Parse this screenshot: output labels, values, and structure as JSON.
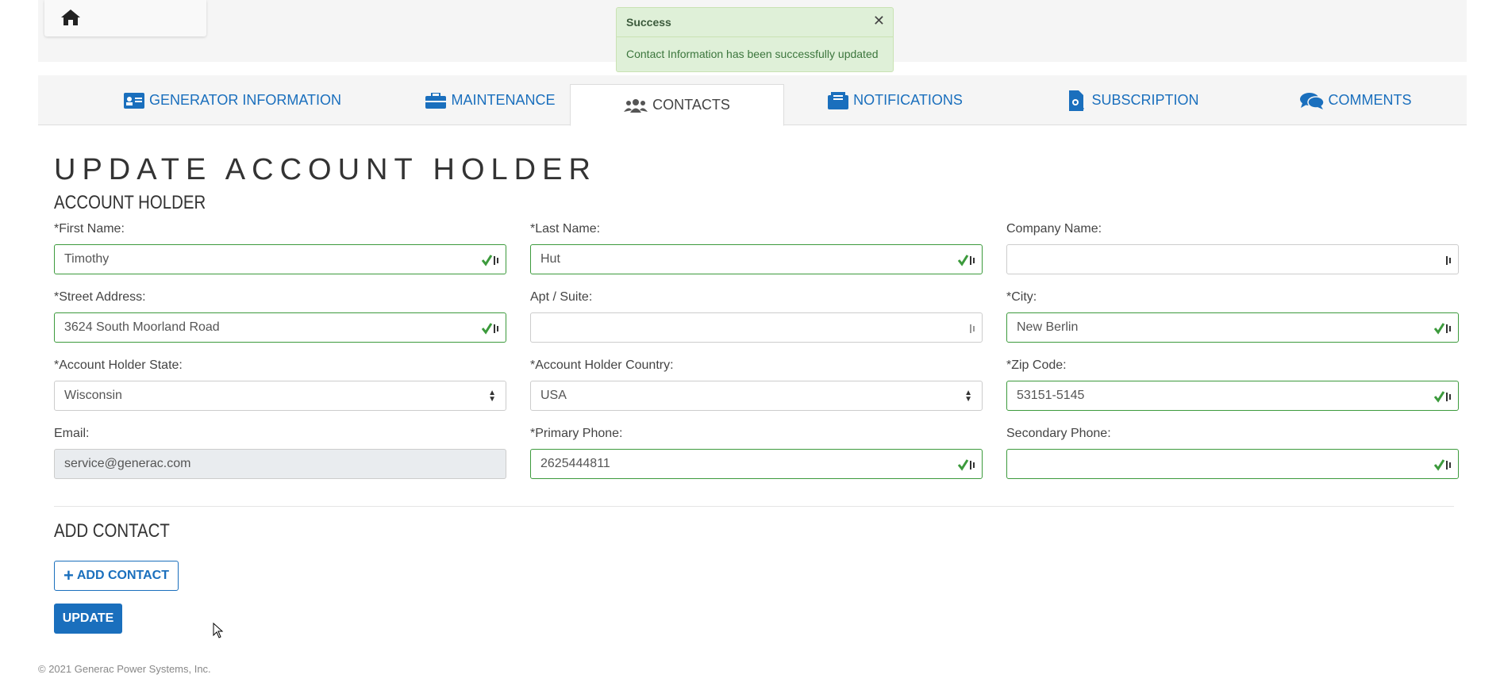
{
  "toast": {
    "title": "Success",
    "close": "✕",
    "message": "Contact Information has been successfully updated"
  },
  "tabs": [
    {
      "label": "Generator Information",
      "icon": "id-card-icon"
    },
    {
      "label": "Maintenance",
      "icon": "toolbox-icon"
    },
    {
      "label": "Contacts",
      "icon": "users-icon",
      "active": true
    },
    {
      "label": "Notifications",
      "icon": "envelope-icon"
    },
    {
      "label": "Subscription",
      "icon": "file-icon"
    },
    {
      "label": "Comments",
      "icon": "comments-icon"
    }
  ],
  "page_title": "Update Account Holder",
  "account_holder": {
    "section_title": "Account Holder",
    "first_name_label": "*First Name:",
    "first_name": "Timothy",
    "last_name_label": "*Last Name:",
    "last_name": "Hut",
    "company_label": "Company Name:",
    "company": "",
    "street_label": "*Street Address:",
    "street": "3624 South Moorland Road",
    "apt_label": "Apt / Suite:",
    "apt": "",
    "city_label": "*City:",
    "city": "New Berlin",
    "state_label": "*Account Holder State:",
    "state": "Wisconsin",
    "country_label": "*Account Holder Country:",
    "country": "USA",
    "zip_label": "*Zip Code:",
    "zip": "53151-5145",
    "email_label": "Email:",
    "email": "service@generac.com",
    "primary_phone_label": "*Primary Phone:",
    "primary_phone": "2625444811",
    "secondary_phone_label": "Secondary Phone:",
    "secondary_phone": ""
  },
  "add_contact": {
    "section_title": "Add Contact",
    "button_label": "Add Contact"
  },
  "update_label": "Update",
  "footer": "© 2021 Generac Power Systems, Inc.",
  "colors": {
    "accent": "#1a6fbd",
    "valid": "#3c9a3c",
    "toast_bg": "#dff0d8"
  }
}
